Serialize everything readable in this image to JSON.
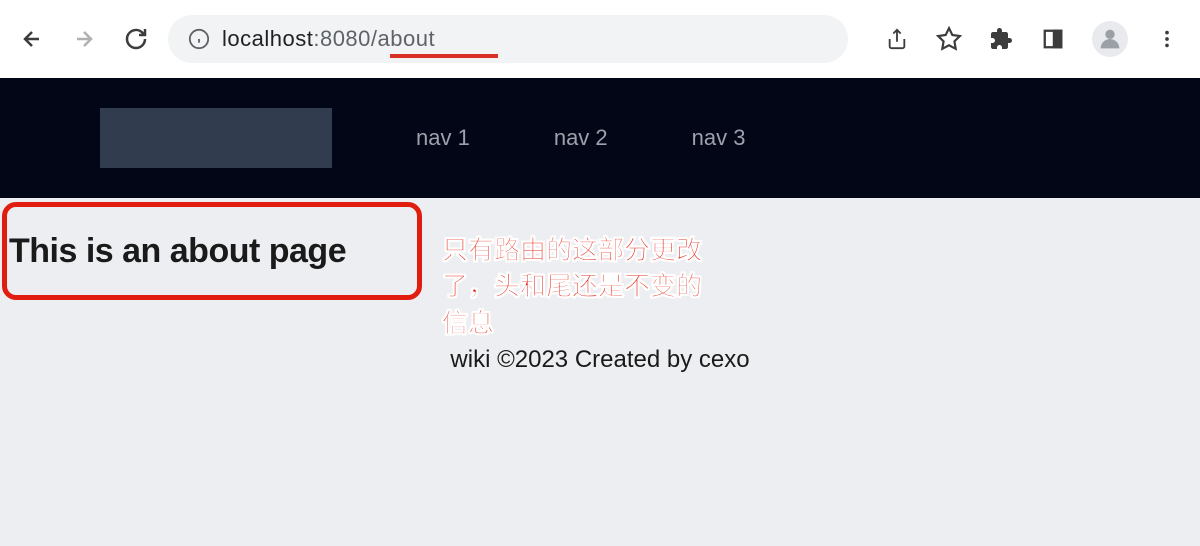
{
  "browser": {
    "url_protocol": "localhost",
    "url_port": ":8080",
    "url_path": "/about"
  },
  "header": {
    "nav_items": [
      "nav 1",
      "nav 2",
      "nav 3"
    ]
  },
  "main": {
    "heading": "This is an about page"
  },
  "annotation": {
    "line1": "只有路由的这部分更改",
    "line2": "了，头和尾还是不变的",
    "line3": "信息"
  },
  "footer": {
    "text": "wiki ©2023 Created by cexo"
  }
}
